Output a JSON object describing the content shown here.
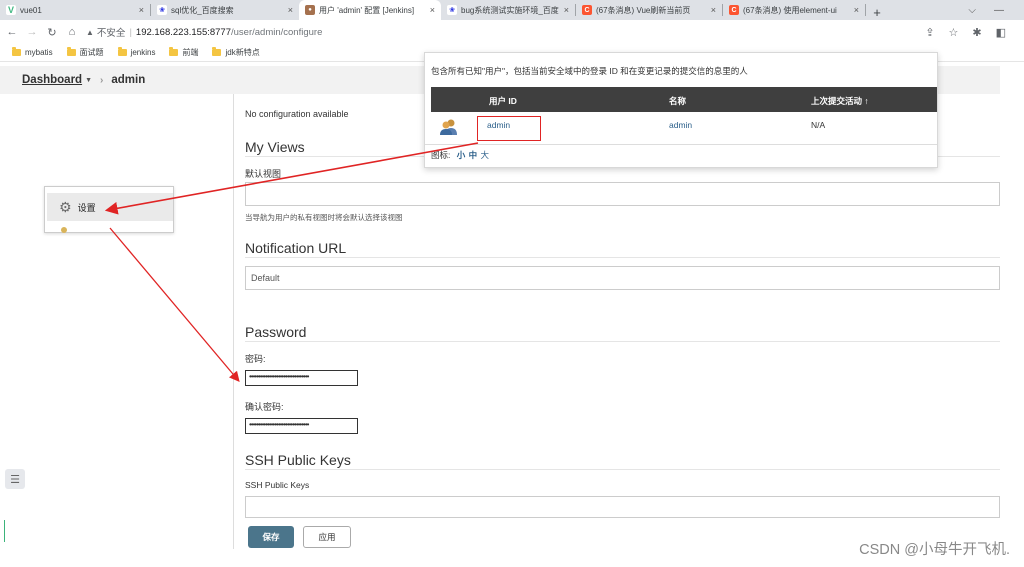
{
  "browser": {
    "tabs": [
      {
        "label": "vue01",
        "icon": "vue-icon",
        "icon_color": "#41b883",
        "icon_text": "V"
      },
      {
        "label": "sql优化_百度搜索",
        "icon": "baidu-paw-icon",
        "icon_color": "#2932e1",
        "icon_text": "❀"
      },
      {
        "label": "用户 'admin' 配置 [Jenkins]",
        "icon": "jenkins-icon",
        "icon_color": "#a5714e",
        "icon_text": "●",
        "active": true
      },
      {
        "label": "bug系统测试实施环境_百度",
        "icon": "baidu-paw-icon",
        "icon_color": "#2932e1",
        "icon_text": "❀"
      },
      {
        "label": "(67条消息) Vue刷新当前页",
        "icon": "csdn-icon",
        "icon_color": "#fc5531",
        "icon_text": "C"
      },
      {
        "label": "(67条消息) 使用element-ui",
        "icon": "csdn-icon",
        "icon_color": "#fc5531",
        "icon_text": "C"
      }
    ],
    "close_glyph": "×",
    "new_tab": "+",
    "address": {
      "insecure_label": "不安全",
      "url_host": "192.168.223.155:8777",
      "url_path": "/user/admin/configure"
    },
    "bookmarks": [
      "mybatis",
      "面试题",
      "jenkins",
      "前端",
      "jdk新特点"
    ]
  },
  "breadcrumb": {
    "dashboard": "Dashboard",
    "user": "admin"
  },
  "config": {
    "no_config": "No configuration available",
    "my_views_title": "My Views",
    "default_view_label": "默认视图",
    "default_view_hint": "当导航为用户的私有视图时将会默认选择该视图",
    "notification_title": "Notification URL",
    "notification_value": "Default",
    "password_title": "Password",
    "password_label": "密码:",
    "password_dots": "•••••••••••••••••••••••••••••••••",
    "confirm_label": "确认密码:",
    "confirm_dots": "•••••••••••••••••••••••••••••••••",
    "ssh_title": "SSH Public Keys",
    "ssh_label": "SSH Public Keys",
    "save_button": "保存",
    "apply_button": "应用"
  },
  "side_menu": {
    "settings_label": "设置"
  },
  "popup": {
    "description": "包含所有已知\"用户\"，包括当前安全域中的登录 ID 和在变更记录的提交信的息里的人",
    "columns": [
      "用户 ID",
      "名称",
      "上次提交活动 ↑"
    ],
    "rows": [
      {
        "user_id": "admin",
        "name": "admin",
        "last_commit": "N/A"
      }
    ],
    "icon_label": "图标:",
    "sizes": [
      "小",
      "中",
      "大"
    ]
  },
  "watermark": "CSDN @小母牛开飞机.",
  "colors": {
    "annotation_red": "#e02424",
    "jenkins_header": "#3f3f3f",
    "save_button": "#4b758b"
  }
}
